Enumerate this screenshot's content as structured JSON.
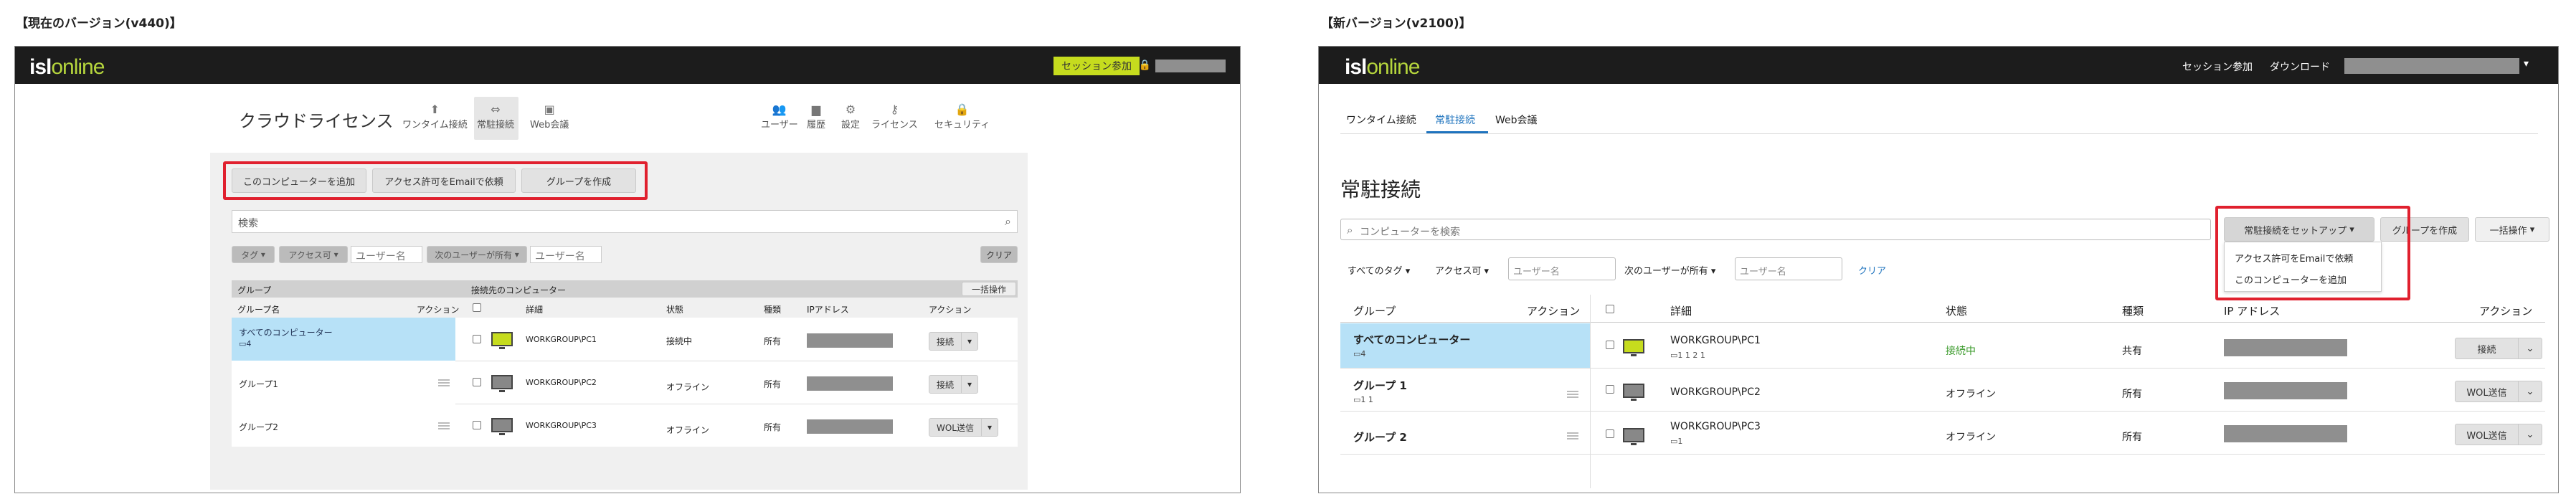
{
  "captions": {
    "old": "【現在のバージョン(v440)】",
    "new": "【新バージョン(v2100)】"
  },
  "brand": {
    "isl": "isl",
    "online": "online",
    "accent": "#b5d53d",
    "highlight": "#e0202e"
  },
  "old": {
    "header": {
      "session_join": "セッション参加"
    },
    "page_title": "クラウドライセンス",
    "tabs": [
      {
        "label": "ワンタイム接続",
        "icon": "monitor-arrow-icon"
      },
      {
        "label": "常駐接続",
        "icon": "monitor-link-icon"
      },
      {
        "label": "Web会議",
        "icon": "video-icon"
      }
    ],
    "admin": [
      {
        "label": "ユーザー",
        "icon": "users-icon",
        "glyph": "👥"
      },
      {
        "label": "履歴",
        "icon": "bar-chart-icon",
        "glyph": "▆"
      },
      {
        "label": "設定",
        "icon": "gear-icon",
        "glyph": "⚙"
      },
      {
        "label": "ライセンス",
        "icon": "key-icon",
        "glyph": "⚷"
      },
      {
        "label": "セキュリティ",
        "icon": "lock-icon",
        "glyph": "🔒"
      }
    ],
    "actions": {
      "add_computer": "このコンピューターを追加",
      "request_access": "アクセス許可をEmailで依頼",
      "create_group": "グループを作成"
    },
    "search_placeholder": "検索",
    "filters": {
      "tag": "タグ",
      "access": "アクセス可",
      "username_placeholder": "ユーザー名",
      "next_owner": "次のユーザーが所有",
      "username2_placeholder": "ユーザー名",
      "clear": "クリア"
    },
    "group_header": "グループ",
    "dest_header": "接続先のコンピューター",
    "bulk": "一括操作",
    "cols": {
      "group_name": "グループ名",
      "action": "アクション",
      "detail": "詳細",
      "status": "状態",
      "kind": "種類",
      "ip": "IPアドレス",
      "action2": "アクション"
    },
    "groups": [
      {
        "name": "すべてのコンピューター",
        "count": "4"
      },
      {
        "name": "グループ1"
      },
      {
        "name": "グループ2"
      }
    ],
    "computers": [
      {
        "name": "WORKGROUP\\PC1",
        "status": "接続中",
        "kind": "所有",
        "action": "接続"
      },
      {
        "name": "WORKGROUP\\PC2",
        "status": "オフライン",
        "kind": "所有",
        "action": "接続"
      },
      {
        "name": "WORKGROUP\\PC3",
        "status": "オフライン",
        "kind": "所有",
        "action": "WOL送信"
      }
    ]
  },
  "new": {
    "header": {
      "session_join": "セッション参加",
      "download": "ダウンロード"
    },
    "tabs": [
      "ワンタイム接続",
      "常駐接続",
      "Web会議"
    ],
    "page_title": "常駐接続",
    "search_placeholder": "コンピューターを検索",
    "setup_button": "常駐接続をセットアップ",
    "create_group": "グループを作成",
    "bulk": "一括操作",
    "dropdown": [
      "アクセス許可をEmailで依頼",
      "このコンピューターを追加"
    ],
    "filters": {
      "all_tags": "すべてのタグ",
      "access": "アクセス可",
      "username_placeholder": "ユーザー名",
      "next_owner": "次のユーザーが所有",
      "username2_placeholder": "ユーザー名",
      "clear": "クリア"
    },
    "cols": {
      "group": "グループ",
      "action": "アクション",
      "detail": "詳細",
      "status": "状態",
      "kind": "種類",
      "ip": "IP アドレス",
      "action2": "アクション"
    },
    "groups": [
      {
        "name": "すべてのコンピューター",
        "meta": "4"
      },
      {
        "name": "グループ 1",
        "meta": "1  1"
      },
      {
        "name": "グループ 2"
      }
    ],
    "computers": [
      {
        "name": "WORKGROUP\\PC1",
        "meta": "1  1  2  1",
        "status": "接続中",
        "kind": "共有",
        "action": "接続"
      },
      {
        "name": "WORKGROUP\\PC2",
        "meta": "",
        "status": "オフライン",
        "kind": "所有",
        "action": "WOL送信"
      },
      {
        "name": "WORKGROUP\\PC3",
        "meta": "1",
        "status": "オフライン",
        "kind": "所有",
        "action": "WOL送信"
      }
    ]
  }
}
